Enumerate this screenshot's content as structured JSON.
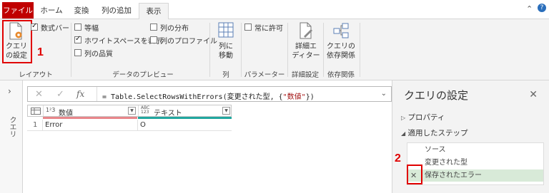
{
  "tabs": [
    "ファイル",
    "ホーム",
    "変換",
    "列の追加",
    "表示"
  ],
  "ribbon": {
    "query_settings_btn": [
      "クエリ",
      "の設定"
    ],
    "formula_bar": "数式バー",
    "monospace": "等幅",
    "show_whitespace": "ホワイトスペースを表示",
    "column_quality": "列の品質",
    "column_distribution": "列の分布",
    "column_profile": "列のプロファイル",
    "go_to_column": [
      "列に",
      "移動"
    ],
    "always_allow": "常に許可",
    "advanced_editor": [
      "詳細エ",
      "ディター"
    ],
    "query_dependencies": [
      "クエリの",
      "依存関係"
    ],
    "groups": {
      "layout": "レイアウト",
      "data_preview": "データのプレビュー",
      "columns": "列",
      "parameters": "パラメーター",
      "advanced": "詳細設定",
      "dependencies": "依存関係"
    }
  },
  "callouts": {
    "one": "1",
    "two": "2"
  },
  "left_pane": {
    "label": "クエリ"
  },
  "formula": {
    "prefix": "= Table.SelectRowsWithErrors(変更された型, {",
    "string": "\"数値\"",
    "suffix": "})"
  },
  "grid": {
    "columns": [
      {
        "type": "1²3",
        "name": "数値"
      },
      {
        "type": "ABC 123",
        "name": "テキスト"
      }
    ],
    "rows": [
      {
        "index": "1",
        "cells": [
          "Error",
          "O"
        ]
      }
    ]
  },
  "query_settings": {
    "title": "クエリの設定",
    "properties": "プロパティ",
    "applied_steps": "適用したステップ",
    "steps": [
      "ソース",
      "変更された型",
      "保存されたエラー"
    ]
  },
  "colors": {
    "file_tab": "#c00000",
    "accent_green": "#217346",
    "callout_red": "#e00000",
    "quality_red": "#e8868a",
    "quality_teal": "#21a79f"
  }
}
